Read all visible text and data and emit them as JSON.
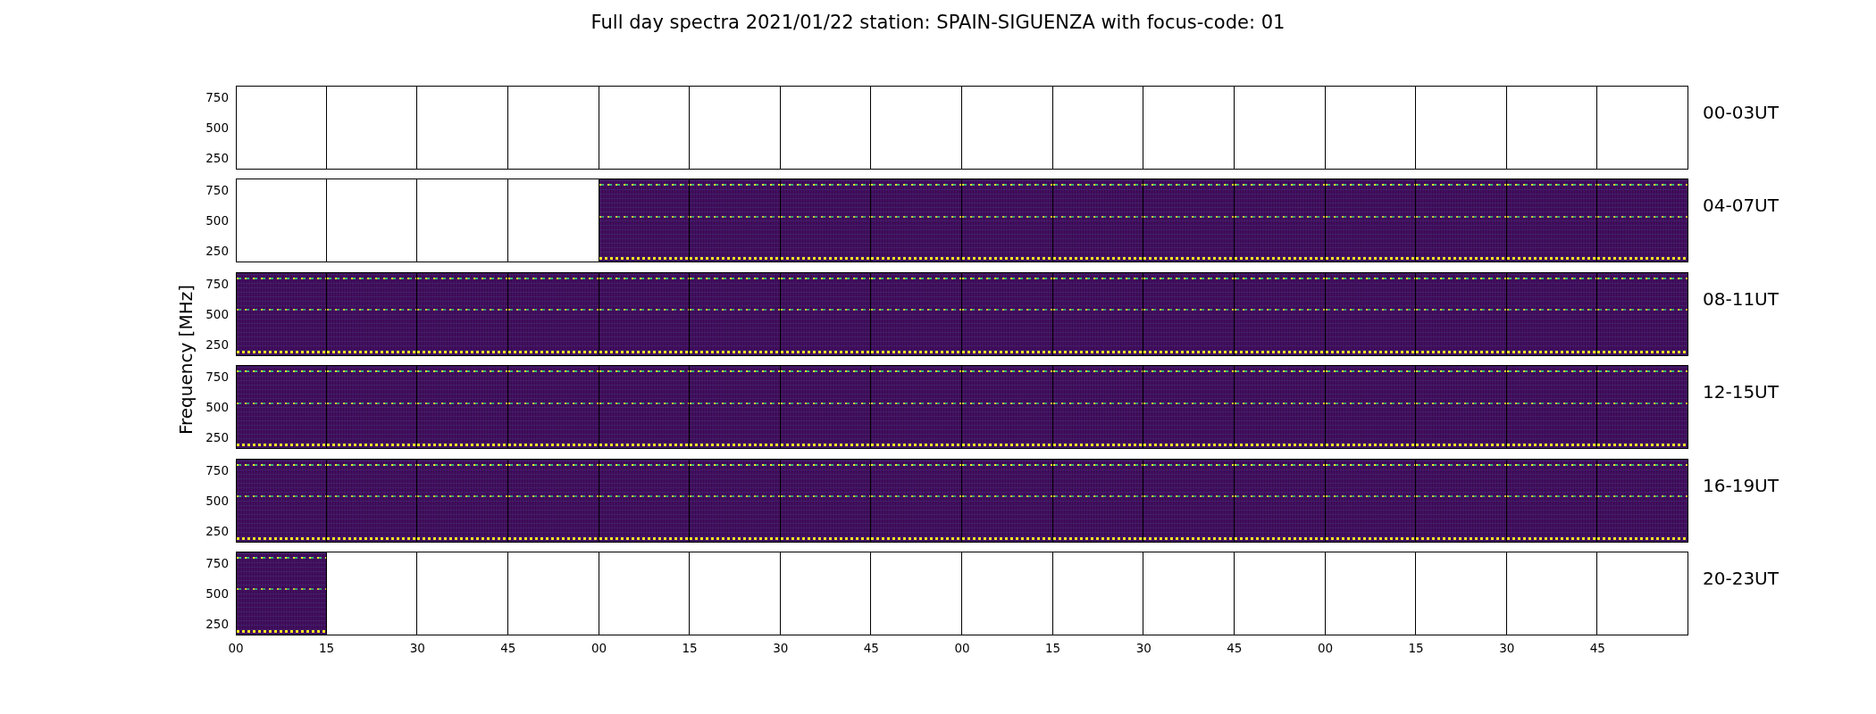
{
  "title": "Full day spectra 2021/01/22 station: SPAIN-SIGUENZA with focus-code: 01",
  "y_axis_label": "Frequency [MHz]",
  "x_ticks": [
    "00",
    "15",
    "30",
    "45",
    "00",
    "15",
    "30",
    "45",
    "00",
    "15",
    "30",
    "45",
    "00",
    "15",
    "30",
    "45"
  ],
  "rows": [
    {
      "label": "00-03UT",
      "y_ticks": [
        "750",
        "500",
        "250"
      ],
      "panels": [
        {
          "has_data": false
        },
        {
          "has_data": false
        },
        {
          "has_data": false
        },
        {
          "has_data": false
        },
        {
          "has_data": false
        },
        {
          "has_data": false
        },
        {
          "has_data": false
        },
        {
          "has_data": false
        },
        {
          "has_data": false
        },
        {
          "has_data": false
        },
        {
          "has_data": false
        },
        {
          "has_data": false
        },
        {
          "has_data": false
        },
        {
          "has_data": false
        },
        {
          "has_data": false
        },
        {
          "has_data": false
        }
      ]
    },
    {
      "label": "04-07UT",
      "y_ticks": [
        "750",
        "500",
        "250"
      ],
      "panels": [
        {
          "has_data": false
        },
        {
          "has_data": false
        },
        {
          "has_data": false
        },
        {
          "has_data": false
        },
        {
          "has_data": true
        },
        {
          "has_data": true
        },
        {
          "has_data": true
        },
        {
          "has_data": true
        },
        {
          "has_data": true
        },
        {
          "has_data": true
        },
        {
          "has_data": true
        },
        {
          "has_data": true
        },
        {
          "has_data": true
        },
        {
          "has_data": true
        },
        {
          "has_data": true
        },
        {
          "has_data": true
        }
      ]
    },
    {
      "label": "08-11UT",
      "y_ticks": [
        "750",
        "500",
        "250"
      ],
      "panels": [
        {
          "has_data": true
        },
        {
          "has_data": true
        },
        {
          "has_data": true
        },
        {
          "has_data": true
        },
        {
          "has_data": true
        },
        {
          "has_data": true
        },
        {
          "has_data": true
        },
        {
          "has_data": true
        },
        {
          "has_data": true
        },
        {
          "has_data": true
        },
        {
          "has_data": true
        },
        {
          "has_data": true
        },
        {
          "has_data": true
        },
        {
          "has_data": true
        },
        {
          "has_data": true
        },
        {
          "has_data": true
        }
      ]
    },
    {
      "label": "12-15UT",
      "y_ticks": [
        "750",
        "500",
        "250"
      ],
      "panels": [
        {
          "has_data": true
        },
        {
          "has_data": true
        },
        {
          "has_data": true
        },
        {
          "has_data": true
        },
        {
          "has_data": true
        },
        {
          "has_data": true
        },
        {
          "has_data": true
        },
        {
          "has_data": true
        },
        {
          "has_data": true
        },
        {
          "has_data": true
        },
        {
          "has_data": true
        },
        {
          "has_data": true
        },
        {
          "has_data": true
        },
        {
          "has_data": true
        },
        {
          "has_data": true
        },
        {
          "has_data": true
        }
      ]
    },
    {
      "label": "16-19UT",
      "y_ticks": [
        "750",
        "500",
        "250"
      ],
      "panels": [
        {
          "has_data": true
        },
        {
          "has_data": true
        },
        {
          "has_data": true
        },
        {
          "has_data": true
        },
        {
          "has_data": true
        },
        {
          "has_data": true
        },
        {
          "has_data": true
        },
        {
          "has_data": true
        },
        {
          "has_data": true
        },
        {
          "has_data": true
        },
        {
          "has_data": true
        },
        {
          "has_data": true
        },
        {
          "has_data": true
        },
        {
          "has_data": true
        },
        {
          "has_data": true
        },
        {
          "has_data": true
        }
      ]
    },
    {
      "label": "20-23UT",
      "y_ticks": [
        "750",
        "500",
        "250"
      ],
      "panels": [
        {
          "has_data": true
        },
        {
          "has_data": false
        },
        {
          "has_data": false
        },
        {
          "has_data": false
        },
        {
          "has_data": false
        },
        {
          "has_data": false
        },
        {
          "has_data": false
        },
        {
          "has_data": false
        },
        {
          "has_data": false
        },
        {
          "has_data": false
        },
        {
          "has_data": false
        },
        {
          "has_data": false
        },
        {
          "has_data": false
        },
        {
          "has_data": false
        },
        {
          "has_data": false
        },
        {
          "has_data": false
        }
      ]
    }
  ]
}
